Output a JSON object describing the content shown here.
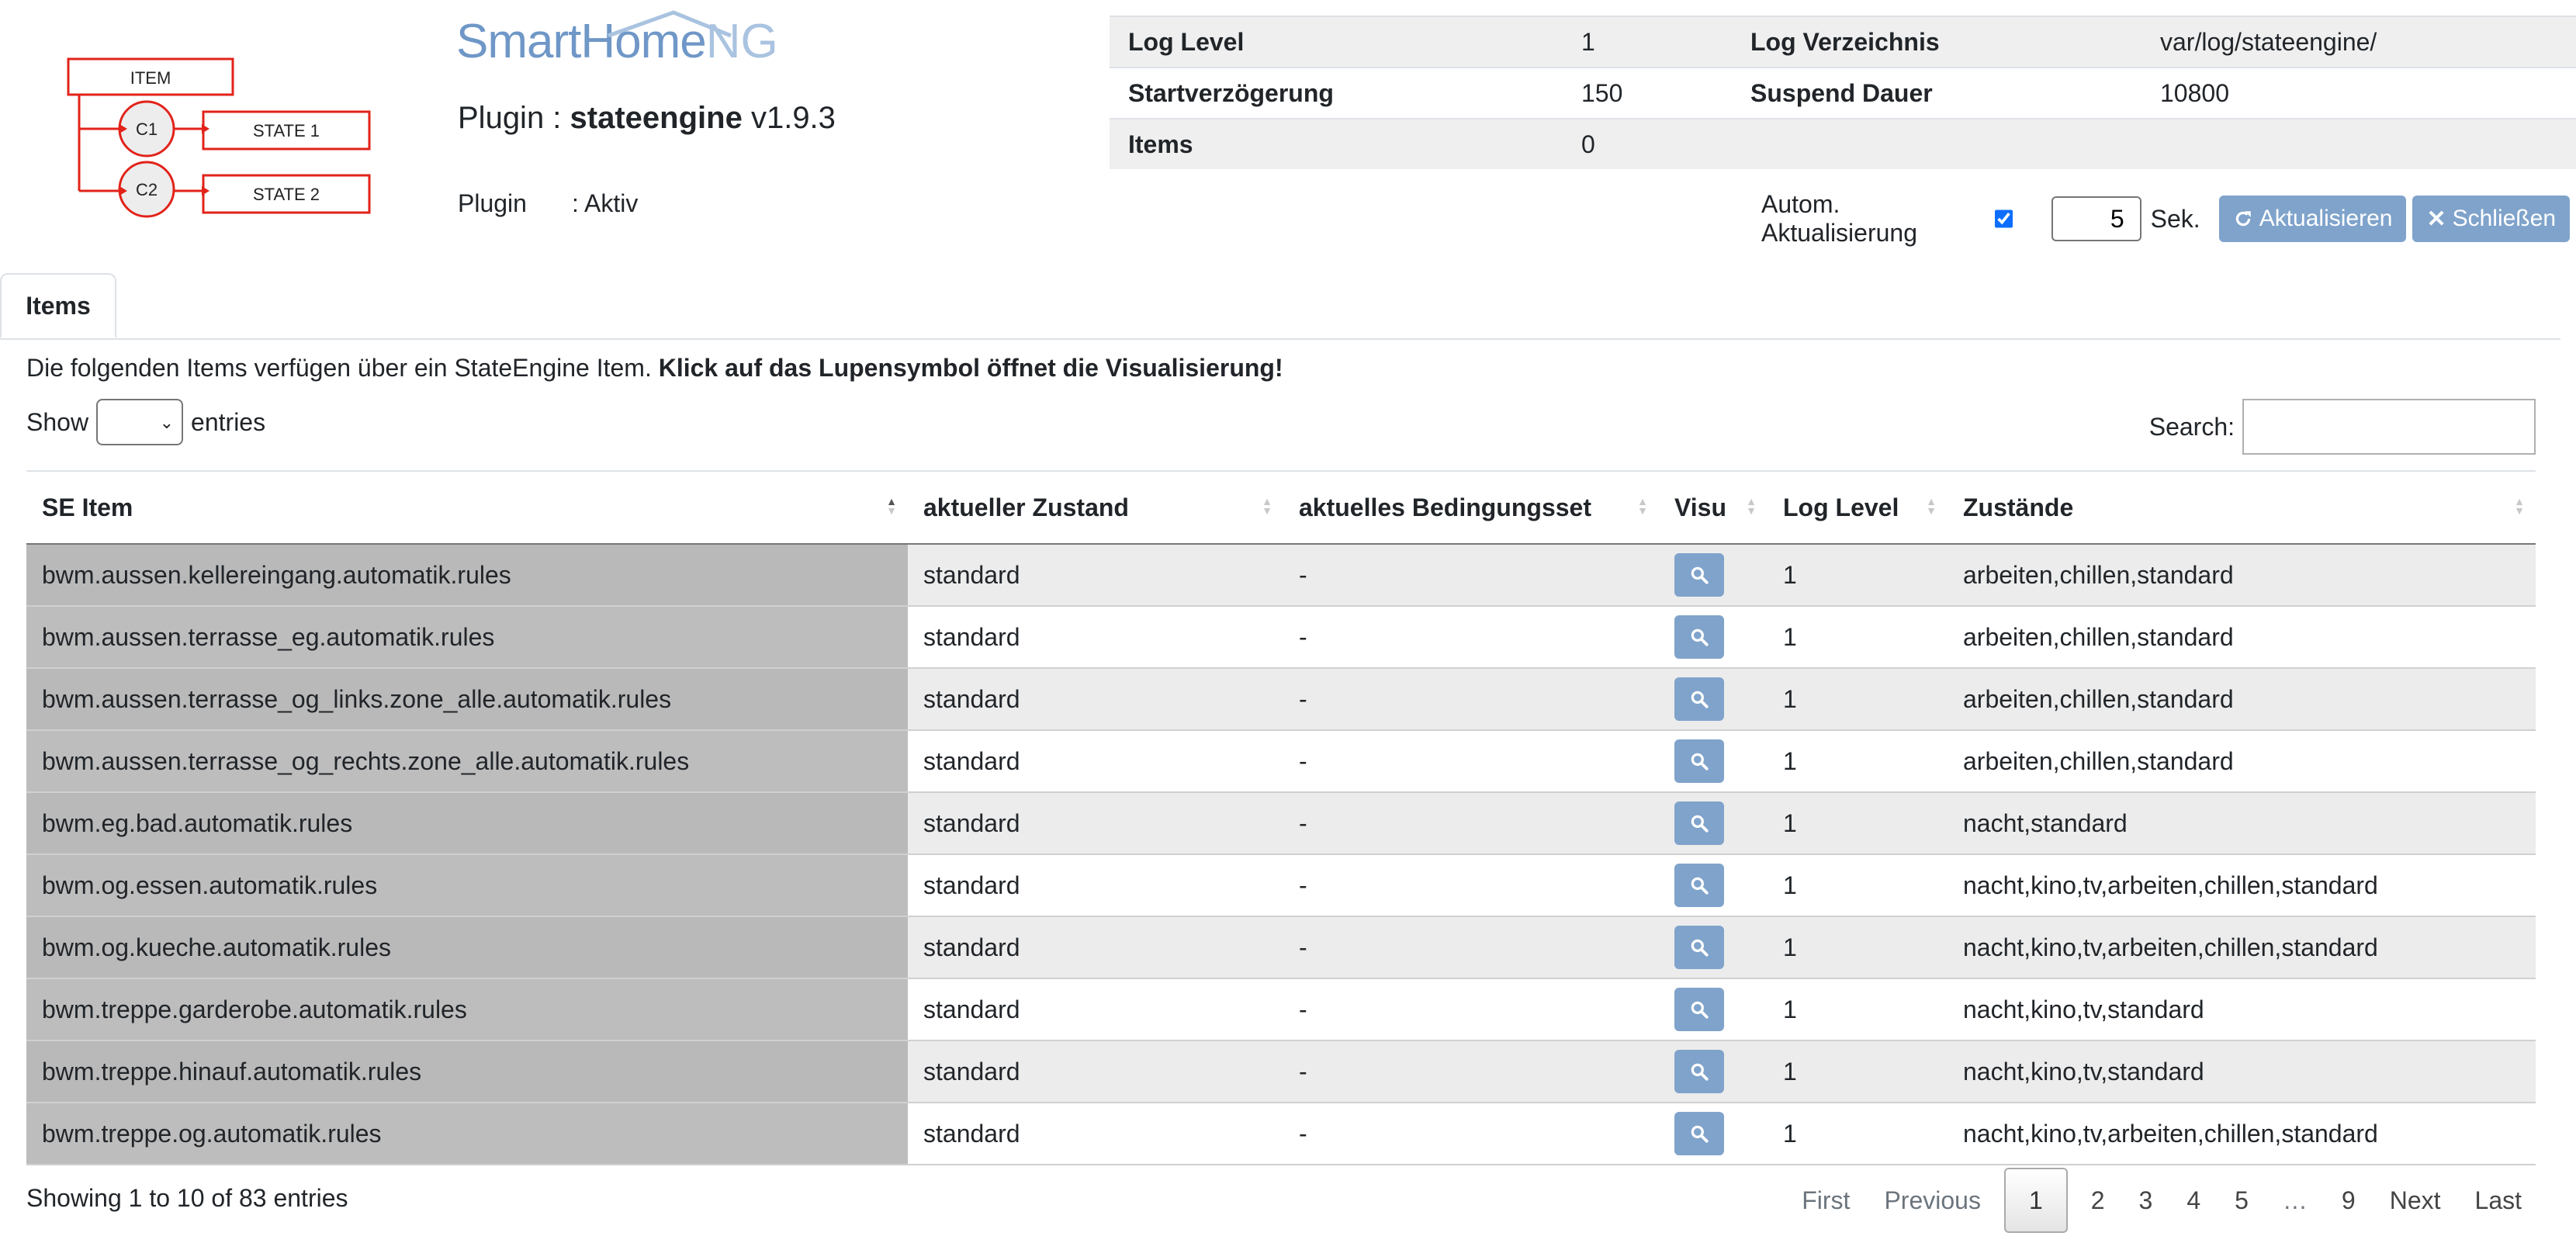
{
  "logo": {
    "item": "ITEM",
    "c1": "C1",
    "c2": "C2",
    "state1": "STATE 1",
    "state2": "STATE 2"
  },
  "brand": {
    "smart": "SmartHome",
    "ng": "NG"
  },
  "plugin": {
    "prefix": "Plugin : ",
    "name": "stateengine",
    "version": "v1.9.3",
    "status_label": "Plugin",
    "status_value": ": Aktiv"
  },
  "info": {
    "log_level_label": "Log Level",
    "log_level_value": "1",
    "log_dir_label": "Log Verzeichnis",
    "log_dir_value": "var/log/stateengine/",
    "start_delay_label": "Startverzögerung",
    "start_delay_value": "150",
    "suspend_label": "Suspend Dauer",
    "suspend_value": "10800",
    "items_label": "Items",
    "items_value": "0"
  },
  "refresh": {
    "label": "Autom. Aktualisierung",
    "checked": true,
    "interval": "5",
    "unit": "Sek.",
    "refresh_button": "Aktualisieren",
    "close_button": "Schließen"
  },
  "tabs": [
    {
      "label": "Items",
      "active": true
    }
  ],
  "description": {
    "text": "Die folgenden Items verfügen über ein StateEngine Item. ",
    "bold": "Klick auf das Lupensymbol öffnet die Visualisierung!"
  },
  "table_controls": {
    "show_label": "Show",
    "entries_label": "entries",
    "search_label": "Search:"
  },
  "table": {
    "columns": [
      "SE Item",
      "aktueller Zustand",
      "aktuelles Bedingungsset",
      "Visu",
      "Log Level",
      "Zustände"
    ],
    "rows": [
      [
        "bwm.aussen.kellereingang.automatik.rules",
        "standard",
        "-",
        "1",
        "arbeiten,chillen,standard"
      ],
      [
        "bwm.aussen.terrasse_eg.automatik.rules",
        "standard",
        "-",
        "1",
        "arbeiten,chillen,standard"
      ],
      [
        "bwm.aussen.terrasse_og_links.zone_alle.automatik.rules",
        "standard",
        "-",
        "1",
        "arbeiten,chillen,standard"
      ],
      [
        "bwm.aussen.terrasse_og_rechts.zone_alle.automatik.rules",
        "standard",
        "-",
        "1",
        "arbeiten,chillen,standard"
      ],
      [
        "bwm.eg.bad.automatik.rules",
        "standard",
        "-",
        "1",
        "nacht,standard"
      ],
      [
        "bwm.og.essen.automatik.rules",
        "standard",
        "-",
        "1",
        "nacht,kino,tv,arbeiten,chillen,standard"
      ],
      [
        "bwm.og.kueche.automatik.rules",
        "standard",
        "-",
        "1",
        "nacht,kino,tv,arbeiten,chillen,standard"
      ],
      [
        "bwm.treppe.garderobe.automatik.rules",
        "standard",
        "-",
        "1",
        "nacht,kino,tv,standard"
      ],
      [
        "bwm.treppe.hinauf.automatik.rules",
        "standard",
        "-",
        "1",
        "nacht,kino,tv,standard"
      ],
      [
        "bwm.treppe.og.automatik.rules",
        "standard",
        "-",
        "1",
        "nacht,kino,tv,arbeiten,chillen,standard"
      ]
    ]
  },
  "footer": {
    "info": "Showing 1 to 10 of 83 entries"
  },
  "pagination": {
    "first": "First",
    "previous": "Previous",
    "pages": [
      "1",
      "2",
      "3",
      "4",
      "5",
      "…",
      "9"
    ],
    "current": "1",
    "next": "Next",
    "last": "Last"
  },
  "colors": {
    "accent_button": "#7fa3cb",
    "brand_blue": "#6f97c7",
    "logo_red": "#e2231a"
  }
}
